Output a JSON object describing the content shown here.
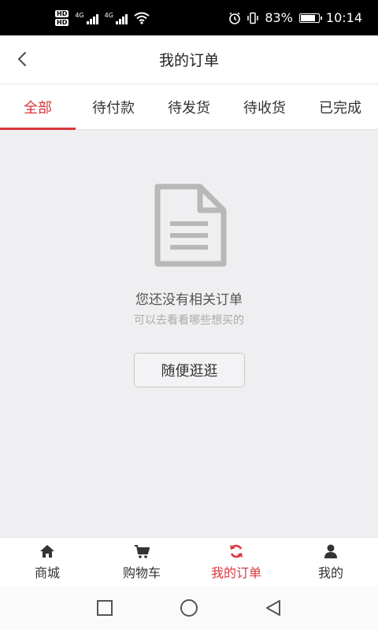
{
  "status_bar": {
    "hd_badges": [
      "HD",
      "HD"
    ],
    "network": [
      "4G",
      "4G"
    ],
    "battery_percent": "83%",
    "battery_level": 0.83,
    "time": "10:14",
    "icons": [
      "signal-icon",
      "wifi-icon",
      "alarm-icon",
      "vibrate-icon",
      "battery-icon"
    ]
  },
  "header": {
    "title": "我的订单",
    "back_icon": "chevron-left-icon"
  },
  "tabs": [
    {
      "label": "全部",
      "active": true
    },
    {
      "label": "待付款",
      "active": false
    },
    {
      "label": "待发货",
      "active": false
    },
    {
      "label": "待收货",
      "active": false
    },
    {
      "label": "已完成",
      "active": false
    }
  ],
  "empty_state": {
    "icon": "document-icon",
    "title": "您还没有相关订单",
    "subtitle": "可以去看看哪些想买的",
    "button_label": "随便逛逛"
  },
  "bottom_nav": [
    {
      "label": "商城",
      "icon": "home-icon",
      "active": false
    },
    {
      "label": "购物车",
      "icon": "cart-icon",
      "active": false
    },
    {
      "label": "我的订单",
      "icon": "refresh-icon",
      "active": true
    },
    {
      "label": "我的",
      "icon": "user-icon",
      "active": false
    }
  ],
  "system_nav": [
    "recents-icon",
    "home-circle-icon",
    "back-triangle-icon"
  ],
  "colors": {
    "accent": "#d9363e",
    "background": "#efeef0",
    "text": "#333333",
    "subtle_text": "#aaaaaa"
  }
}
